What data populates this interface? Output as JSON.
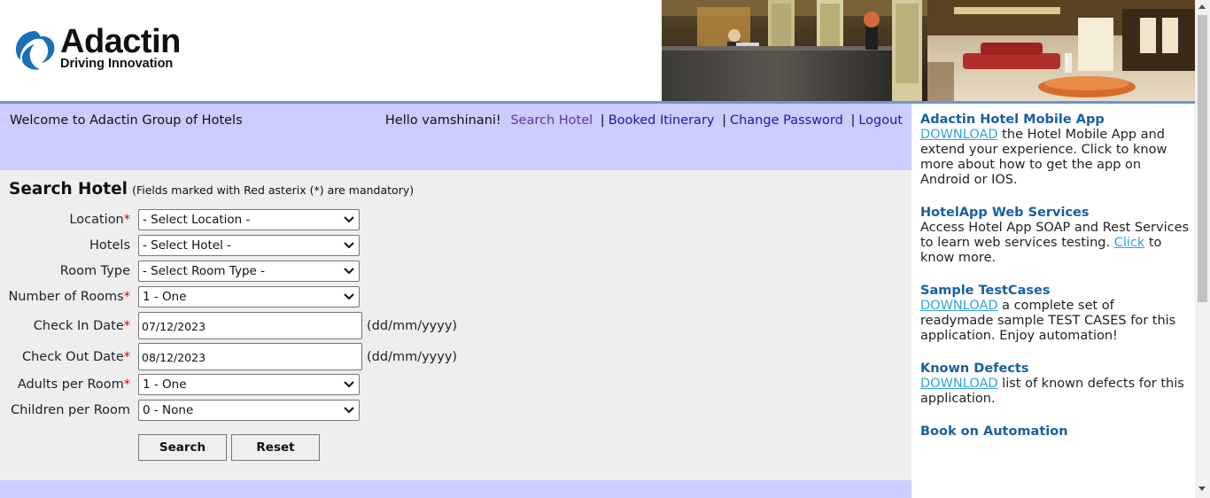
{
  "header": {
    "logo_word": "Adactin",
    "logo_tagline": "Driving Innovation"
  },
  "topbar": {
    "welcome": "Welcome to Adactin Group of Hotels",
    "greeting": "Hello vamshinani!",
    "links": {
      "search": "Search Hotel",
      "booked": "Booked Itinerary",
      "password": "Change Password",
      "logout": "Logout"
    },
    "separator": "|"
  },
  "form": {
    "title": "Search Hotel",
    "note": "(Fields marked with Red asterix (*) are mandatory)",
    "location": {
      "label": "Location",
      "value": "- Select Location -"
    },
    "hotels": {
      "label": "Hotels",
      "value": "- Select Hotel -"
    },
    "room_type": {
      "label": "Room Type",
      "value": "- Select Room Type -"
    },
    "rooms": {
      "label": "Number of Rooms",
      "value": "1 - One"
    },
    "checkin": {
      "label": "Check In Date",
      "value": "07/12/2023",
      "format": "(dd/mm/yyyy)"
    },
    "checkout": {
      "label": "Check Out Date",
      "value": "08/12/2023",
      "format": "(dd/mm/yyyy)"
    },
    "adults": {
      "label": "Adults per Room",
      "value": "1 - One"
    },
    "children": {
      "label": "Children per Room",
      "value": "0 - None"
    },
    "required_mark": "*",
    "search_button": "Search",
    "reset_button": "Reset"
  },
  "sidebar": {
    "mobile": {
      "title": "Adactin Hotel Mobile App",
      "link": "DOWNLOAD",
      "text": " the Hotel Mobile App and extend your experience. Click to know more about how to get the app on Android or IOS."
    },
    "webservices": {
      "title": "HotelApp Web Services",
      "text": "Access Hotel App SOAP and Rest Services to learn web services testing. ",
      "link": "Click",
      "text2": " to know more."
    },
    "testcases": {
      "title": "Sample TestCases",
      "link": "DOWNLOAD",
      "text": " a complete set of readymade sample TEST CASES for this application. Enjoy automation!"
    },
    "defects": {
      "title": "Known Defects",
      "link": "DOWNLOAD",
      "text": " list of known defects for this application."
    },
    "book": {
      "title": "Book on Automation"
    }
  },
  "colors": {
    "nav_bar": "#ccccff",
    "form_bg": "#eeeeee",
    "divider": "#6699cc",
    "sidebar_heading": "#1a5fa0",
    "sidebar_link": "#33a3dc",
    "required": "#dd0000"
  }
}
